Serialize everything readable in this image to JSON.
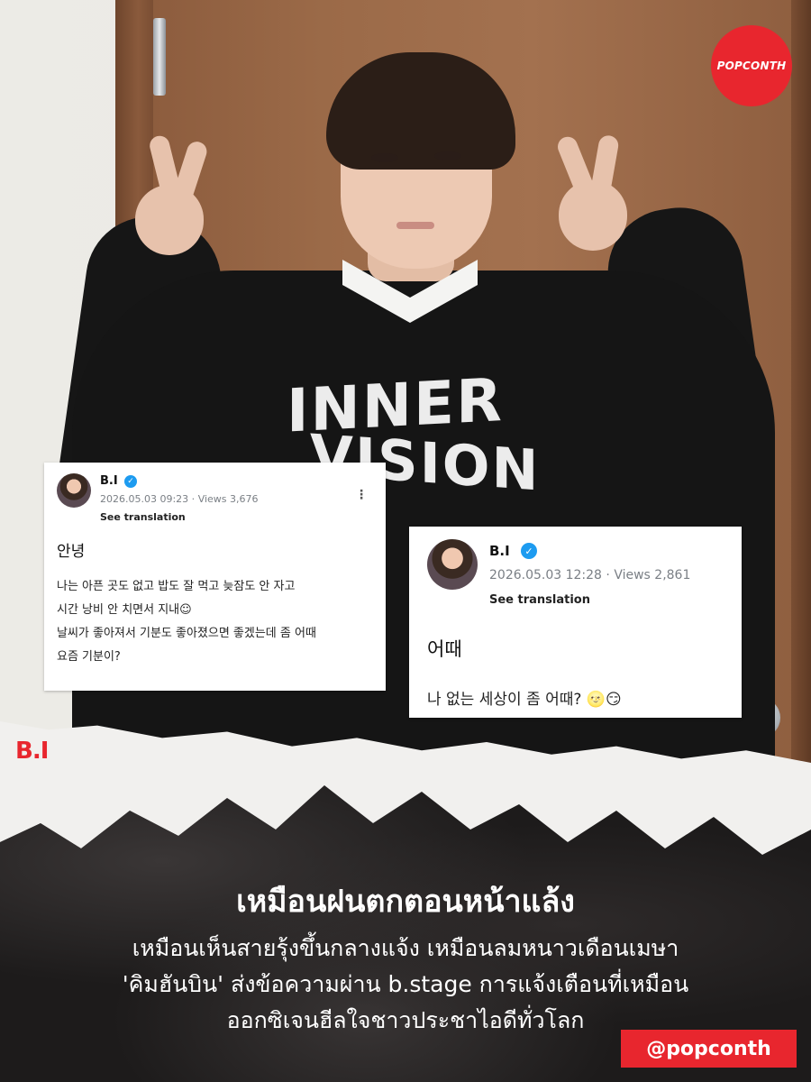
{
  "brand": {
    "badge_text": "POPCONTH",
    "handle": "@popconth",
    "artist_logo": "B.I",
    "accent": "#e8262e"
  },
  "photo": {
    "sweater_print_line1": "INNER",
    "sweater_print_line2": "VISION"
  },
  "posts": [
    {
      "author": "B.I",
      "date": "2026.05.03 09:23",
      "views": "Views 3,676",
      "see_translation": "See translation",
      "title": "안녕",
      "lines": [
        "나는 아픈 곳도 없고 밥도 잘 먹고 늦잠도 안 자고",
        "시간 낭비 안 치면서 지내☺",
        "날씨가 좋아져서 기분도 좋아졌으면 좋겠는데 좀 어때",
        "요즘 기분이?"
      ]
    },
    {
      "author": "B.I",
      "date": "2026.05.03 12:28",
      "views": "Views 2,861",
      "see_translation": "See translation",
      "title": "어때",
      "lines": [
        "나 없는 세상이 좀 어때? 🌝😏"
      ]
    }
  ],
  "caption": {
    "headline": "เหมือนฝนตกตอนหน้าแล้ง",
    "line1": "เหมือนเห็นสายรุ้งขึ้นกลางแจ้ง เหมือนลมหนาวเดือนเมษา",
    "line2": "'คิมฮันบิน' ส่งข้อความผ่าน b.stage การแจ้งเตือนที่เหมือน",
    "line3": "ออกซิเจนฮีลใจชาวประชาไอดีทั่วโลก"
  }
}
